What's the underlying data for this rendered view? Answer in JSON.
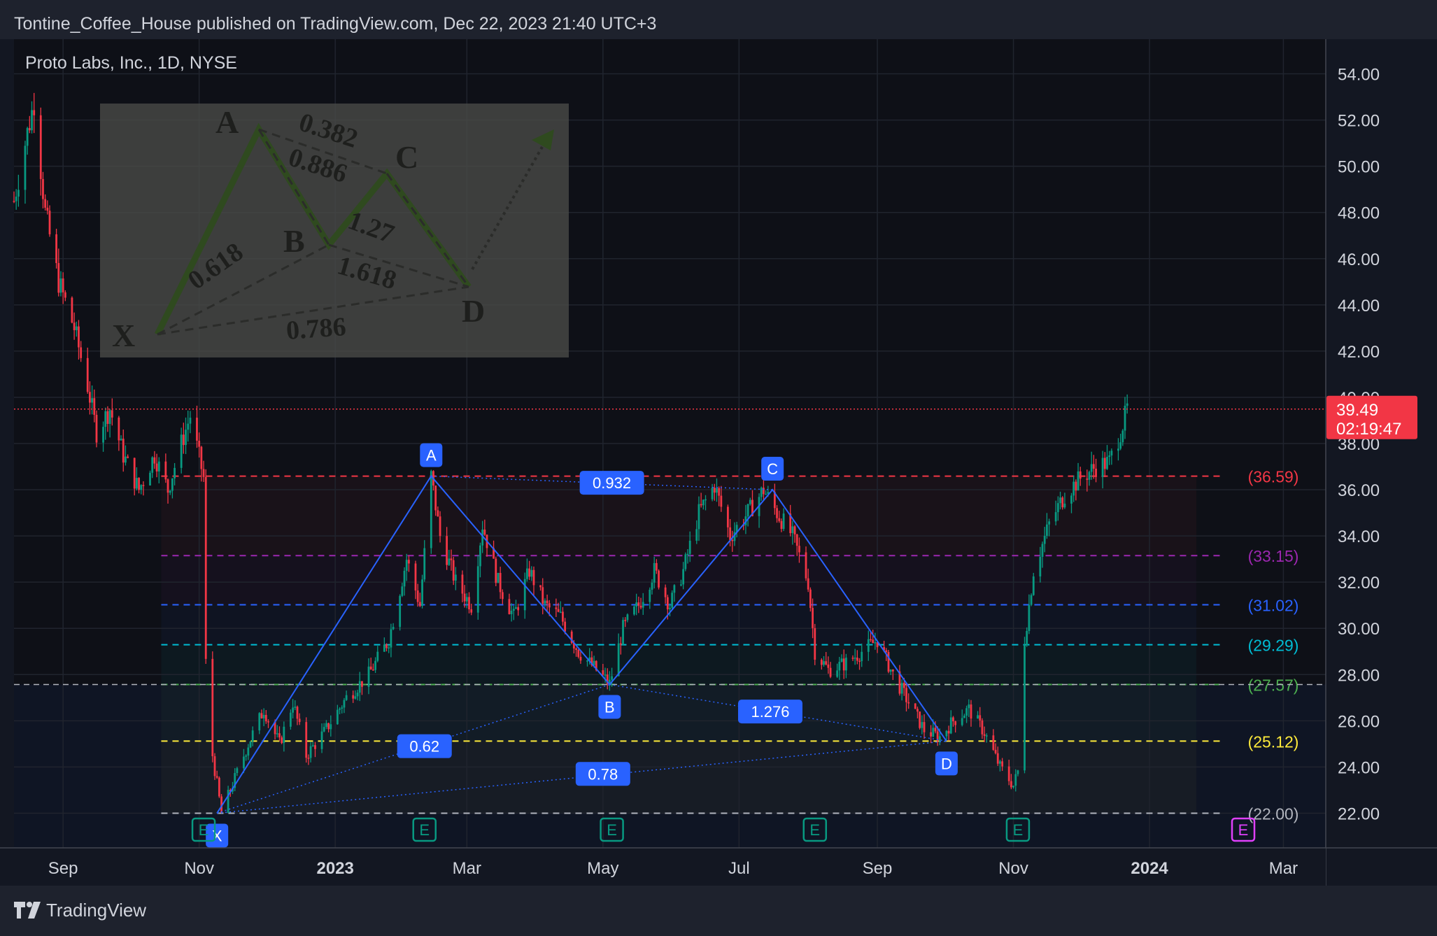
{
  "header": {
    "published": "Tontine_Coffee_House published on TradingView.com, Dec 22, 2023 21:40 UTC+3"
  },
  "footer": {
    "brand": "TradingView"
  },
  "chart_data": {
    "type": "candlestick",
    "symbol_label": "Proto Labs, Inc., 1D, NYSE",
    "ylim": [
      20.5,
      55.5
    ],
    "y_ticks": [
      "54.00",
      "52.00",
      "50.00",
      "48.00",
      "46.00",
      "44.00",
      "42.00",
      "40.00",
      "38.00",
      "36.00",
      "34.00",
      "32.00",
      "30.00",
      "28.00",
      "26.00",
      "24.00",
      "22.00"
    ],
    "x_range": [
      "2022-08-10",
      "2024-03-20"
    ],
    "x_ticks": [
      {
        "label": "Sep",
        "date": "2022-09-01"
      },
      {
        "label": "Nov",
        "date": "2022-11-01"
      },
      {
        "label": "2023",
        "date": "2023-01-01"
      },
      {
        "label": "Mar",
        "date": "2023-03-01"
      },
      {
        "label": "May",
        "date": "2023-05-01"
      },
      {
        "label": "Jul",
        "date": "2023-07-01"
      },
      {
        "label": "Sep",
        "date": "2023-09-01"
      },
      {
        "label": "Nov",
        "date": "2023-11-01"
      },
      {
        "label": "2024",
        "date": "2024-01-01"
      },
      {
        "label": "Mar",
        "date": "2024-03-01"
      }
    ],
    "last_price": {
      "value": 39.49,
      "label": "39.49",
      "countdown": "02:19:47",
      "color": "#f23645"
    },
    "colors": {
      "up": "#089981",
      "down": "#f23645",
      "pattern": "#2962ff"
    },
    "price_path": [
      [
        "2022-08-10",
        48.5
      ],
      [
        "2022-08-15",
        51.0
      ],
      [
        "2022-08-19",
        52.8
      ],
      [
        "2022-08-24",
        48.0
      ],
      [
        "2022-08-30",
        45.0
      ],
      [
        "2022-09-06",
        43.0
      ],
      [
        "2022-09-12",
        40.5
      ],
      [
        "2022-09-16",
        38.5
      ],
      [
        "2022-09-22",
        39.5
      ],
      [
        "2022-09-28",
        37.5
      ],
      [
        "2022-10-05",
        36.0
      ],
      [
        "2022-10-12",
        37.5
      ],
      [
        "2022-10-18",
        36.0
      ],
      [
        "2022-10-24",
        38.0
      ],
      [
        "2022-10-28",
        39.2
      ],
      [
        "2022-11-03",
        36.5
      ],
      [
        "2022-11-04",
        28.5
      ],
      [
        "2022-11-07",
        24.5
      ],
      [
        "2022-11-11",
        22.0
      ],
      [
        "2022-11-17",
        23.5
      ],
      [
        "2022-11-23",
        25.0
      ],
      [
        "2022-11-30",
        26.5
      ],
      [
        "2022-12-07",
        25.0
      ],
      [
        "2022-12-13",
        26.8
      ],
      [
        "2022-12-19",
        24.5
      ],
      [
        "2022-12-27",
        25.5
      ],
      [
        "2023-01-06",
        27.0
      ],
      [
        "2023-01-16",
        28.0
      ],
      [
        "2023-01-25",
        29.5
      ],
      [
        "2023-02-02",
        33.0
      ],
      [
        "2023-02-08",
        31.0
      ],
      [
        "2023-02-13",
        36.6
      ],
      [
        "2023-02-17",
        34.0
      ],
      [
        "2023-02-24",
        32.0
      ],
      [
        "2023-03-03",
        31.0
      ],
      [
        "2023-03-08",
        34.5
      ],
      [
        "2023-03-15",
        32.0
      ],
      [
        "2023-03-22",
        30.5
      ],
      [
        "2023-03-29",
        32.5
      ],
      [
        "2023-04-05",
        31.0
      ],
      [
        "2023-04-12",
        30.5
      ],
      [
        "2023-04-20",
        29.0
      ],
      [
        "2023-04-27",
        28.3
      ],
      [
        "2023-05-04",
        27.6
      ],
      [
        "2023-05-10",
        30.0
      ],
      [
        "2023-05-17",
        31.0
      ],
      [
        "2023-05-24",
        32.5
      ],
      [
        "2023-05-31",
        31.0
      ],
      [
        "2023-06-06",
        32.5
      ],
      [
        "2023-06-13",
        35.0
      ],
      [
        "2023-06-20",
        36.2
      ],
      [
        "2023-06-27",
        34.0
      ],
      [
        "2023-07-05",
        35.0
      ],
      [
        "2023-07-12",
        36.0
      ],
      [
        "2023-07-18",
        35.0
      ],
      [
        "2023-07-25",
        34.0
      ],
      [
        "2023-08-01",
        32.0
      ],
      [
        "2023-08-04",
        29.0
      ],
      [
        "2023-08-10",
        28.2
      ],
      [
        "2023-08-18",
        28.5
      ],
      [
        "2023-08-25",
        29.0
      ],
      [
        "2023-09-01",
        29.5
      ],
      [
        "2023-09-08",
        28.0
      ],
      [
        "2023-09-15",
        26.8
      ],
      [
        "2023-09-22",
        25.6
      ],
      [
        "2023-09-29",
        25.3
      ],
      [
        "2023-10-05",
        26.0
      ],
      [
        "2023-10-12",
        26.5
      ],
      [
        "2023-10-19",
        25.5
      ],
      [
        "2023-10-26",
        24.0
      ],
      [
        "2023-11-01",
        23.2
      ],
      [
        "2023-11-03",
        23.8
      ],
      [
        "2023-11-06",
        29.5
      ],
      [
        "2023-11-10",
        32.5
      ],
      [
        "2023-11-17",
        34.5
      ],
      [
        "2023-11-24",
        35.8
      ],
      [
        "2023-12-01",
        36.5
      ],
      [
        "2023-12-08",
        37.0
      ],
      [
        "2023-12-14",
        37.2
      ],
      [
        "2023-12-19",
        38.5
      ],
      [
        "2023-12-22",
        39.49
      ]
    ],
    "harmonic": {
      "points": [
        {
          "label": "X",
          "date": "2022-11-09",
          "price": 22.0
        },
        {
          "label": "A",
          "date": "2023-02-13",
          "price": 36.59
        },
        {
          "label": "B",
          "date": "2023-05-04",
          "price": 27.57
        },
        {
          "label": "C",
          "date": "2023-07-16",
          "price": 36.0
        },
        {
          "label": "D",
          "date": "2023-10-02",
          "price": 25.12
        }
      ],
      "ratios": [
        {
          "label": "0.62",
          "date": "2023-02-10",
          "price": 24.9
        },
        {
          "label": "0.932",
          "date": "2023-05-05",
          "price": 36.3
        },
        {
          "label": "1.276",
          "date": "2023-07-15",
          "price": 26.4
        },
        {
          "label": "0.78",
          "date": "2023-05-01",
          "price": 23.7
        }
      ]
    },
    "levels": [
      {
        "label": "(36.59)",
        "value": 36.59,
        "color": "#f23645"
      },
      {
        "label": "(33.15)",
        "value": 33.15,
        "color": "#9c27b0"
      },
      {
        "label": "(31.02)",
        "value": 31.02,
        "color": "#2962ff"
      },
      {
        "label": "(29.29)",
        "value": 29.29,
        "color": "#00bcd4"
      },
      {
        "label": "(27.57)",
        "value": 27.57,
        "color": "#4caf50"
      },
      {
        "label": "(25.12)",
        "value": 25.12,
        "color": "#ffeb3b"
      },
      {
        "label": "(22.00)",
        "value": 22.0,
        "color": "#b2b5be"
      }
    ],
    "earnings": {
      "label": "E",
      "dates": [
        "2022-08-04",
        "2022-11-03",
        "2023-02-10",
        "2023-05-05",
        "2023-08-04",
        "2023-11-03"
      ],
      "upcoming": "2024-02-12"
    },
    "inset": {
      "labels": [
        "A",
        "C",
        "B",
        "X",
        "D"
      ],
      "ratios": [
        "0.382",
        "0.886",
        "1.27",
        "0.618",
        "1.618",
        "0.786"
      ]
    }
  }
}
